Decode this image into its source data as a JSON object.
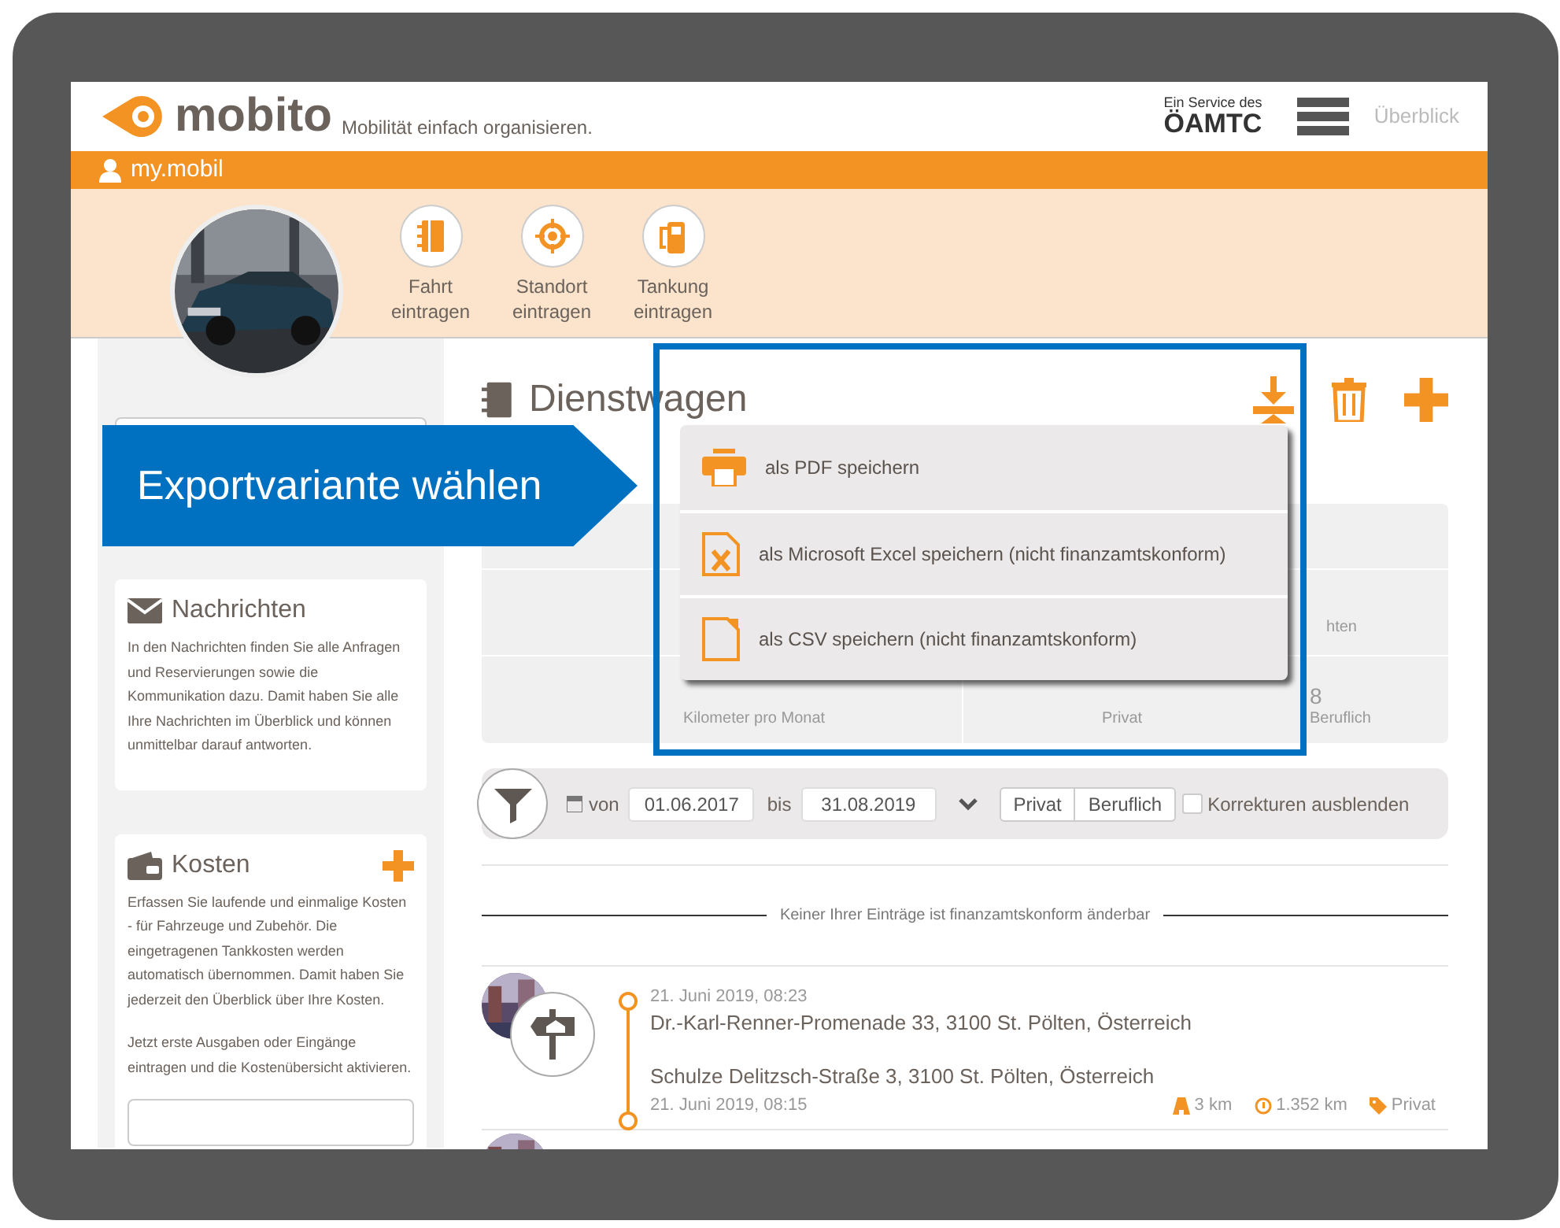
{
  "header": {
    "brand": "mobito",
    "tagline": "Mobilität einfach organisieren.",
    "partner_note": "Ein Service des",
    "partner": "ÖAMTC",
    "nav_link": "Überblick"
  },
  "user_bar": {
    "label": "my.mobil"
  },
  "quick_actions": [
    {
      "kind": "trip",
      "label": "Fahrt eintragen"
    },
    {
      "kind": "location",
      "label": "Standort eintragen"
    },
    {
      "kind": "fuel",
      "label": "Tankung eintragen"
    }
  ],
  "sidebar": {
    "cards": [
      {
        "kind": "messages",
        "title": "Nachrichten",
        "paragraphs": [
          "In den Nachrichten finden Sie alle Anfragen und Reservierungen sowie die Kommunikation dazu. Damit haben Sie alle Ihre Nachrichten im Überblick und können unmittelbar darauf antworten."
        ]
      },
      {
        "kind": "costs",
        "title": "Kosten",
        "paragraphs": [
          "Erfassen Sie laufende und einmalige Kosten - für Fahrzeuge und Zubehör. Die eingetragenen Tankkosten werden automatisch übernommen. Damit haben Sie jederzeit den Überblick über Ihre Kosten.",
          "Jetzt erste Ausgaben oder Eingänge eintragen und die Kostenübersicht aktivieren."
        ]
      }
    ]
  },
  "vehicle": {
    "title": "Dienstwagen"
  },
  "stats": {
    "partial_label": "hten",
    "cells": [
      {
        "label": "Kilometer pro Monat"
      },
      {
        "label": "Privat"
      },
      {
        "value": "8",
        "label": "Beruflich"
      }
    ]
  },
  "callout": {
    "text": "Exportvariante wählen"
  },
  "export_menu": [
    {
      "kind": "pdf",
      "label": "als PDF speichern"
    },
    {
      "kind": "excel",
      "label": "als Microsoft Excel speichern (nicht finanzamtskonform)"
    },
    {
      "kind": "csv",
      "label": "als CSV speichern (nicht finanzamtskonform)"
    }
  ],
  "filter": {
    "from_label": "von",
    "from": "01.06.2017",
    "to_label": "bis",
    "to": "31.08.2019",
    "segments": [
      {
        "label": "Privat",
        "selected": false
      },
      {
        "label": "Beruflich",
        "selected": false
      }
    ],
    "checkbox": {
      "label": "Korrekturen ausblenden",
      "checked": false
    }
  },
  "notice": "Keiner Ihrer Einträge ist finanzamtskonform änderbar",
  "trips": [
    {
      "start_time": "21. Juni 2019, 08:23",
      "start_address": "Dr.-Karl-Renner-Promenade 33, 3100 St. Pölten, Österreich",
      "end_address": "Schulze Delitzsch-Straße 3, 3100 St. Pölten, Österreich",
      "end_time": "21. Juni 2019, 08:15",
      "distance": "3 km",
      "odometer": "1.352 km",
      "category": "Privat"
    }
  ]
}
